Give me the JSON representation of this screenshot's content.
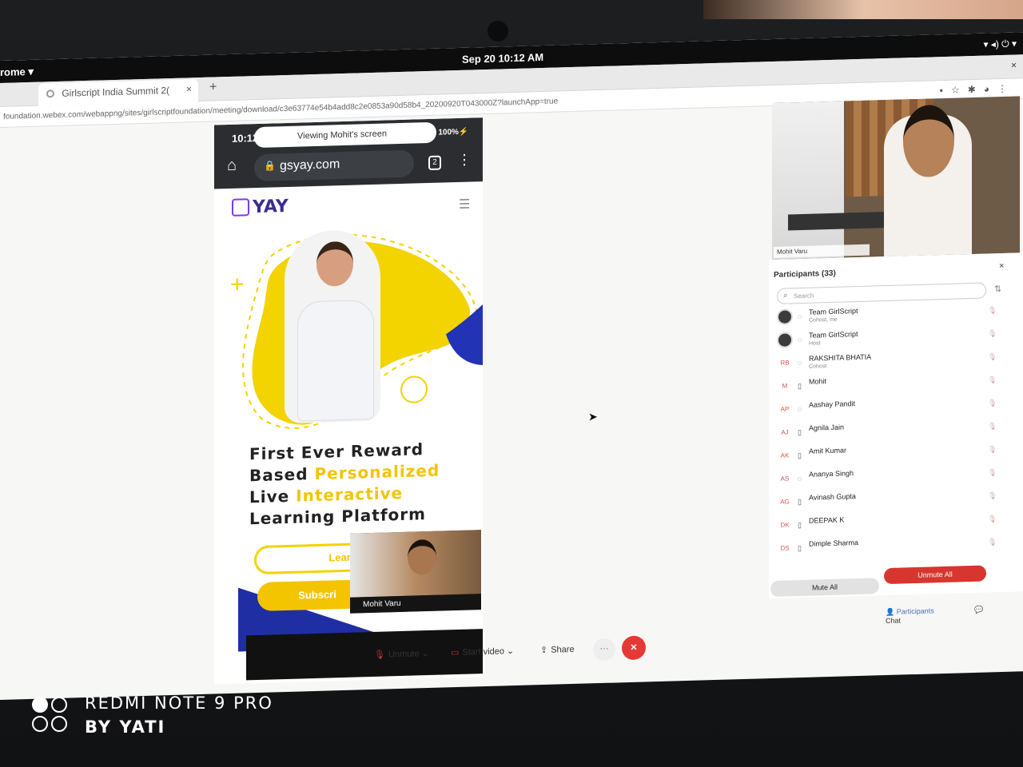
{
  "system": {
    "activities": "rome ▾",
    "clock": "Sep 20  10:12 AM",
    "tray": "▾ ◂) ⏻ ▾"
  },
  "browser": {
    "tab_title": "Girlscript India Summit 2(",
    "tab_close": "×",
    "new_tab": "+",
    "window_close": "×",
    "url": "foundation.webex.com/webappng/sites/girlscriptfoundation/meeting/download/c3e63774e54b4add8c2e0853a90d58b4_20200920T043000Z?launchApp=true",
    "icons": [
      "▪",
      "☆",
      "✱",
      "◕",
      "⋮"
    ]
  },
  "shared_screen": {
    "phone_time": "10:12",
    "viewing_banner": "Viewing Mohit's screen",
    "battery": "ıl 100%⚡",
    "address": "gsyay.com",
    "tab_count": "2",
    "logo_text": "YAY",
    "headline": {
      "line1": "First Ever Reward",
      "line2_a": "Based ",
      "line2_b": "Personalized",
      "line3_a": "Live ",
      "line3_b": "Interactive",
      "line4": "Learning Platform"
    },
    "learn_button": "Learn",
    "subscribe_button": "Subscri"
  },
  "self_view": {
    "name": "Mohit Varu"
  },
  "meeting_controls": {
    "unmute": "Unmute",
    "start_video": "Start video",
    "share": "Share",
    "more": "···",
    "end": "✕"
  },
  "active_speaker": {
    "name": "Mohit Varu"
  },
  "participants_panel": {
    "title": "Participants (33)",
    "search_placeholder": "Search",
    "close": "×",
    "participants": [
      {
        "initials": "",
        "name": "Team GirlScript",
        "role": "Cohost, me",
        "device": "◌"
      },
      {
        "initials": "",
        "name": "Team GirlScript",
        "role": "Host",
        "device": "◌"
      },
      {
        "initials": "RB",
        "name": "RAKSHITA BHATIA",
        "role": "Cohost",
        "device": "◌"
      },
      {
        "initials": "M",
        "name": "Mohit",
        "role": "",
        "device": "▯"
      },
      {
        "initials": "AP",
        "name": "Aashay Pandit",
        "role": "",
        "device": "◌"
      },
      {
        "initials": "AJ",
        "name": "Agnila Jain",
        "role": "",
        "device": "▯"
      },
      {
        "initials": "AK",
        "name": "Amit Kumar",
        "role": "",
        "device": "▯"
      },
      {
        "initials": "AS",
        "name": "Ananya Singh",
        "role": "",
        "device": "◌"
      },
      {
        "initials": "AG",
        "name": "Avinash Gupta",
        "role": "",
        "device": "▯"
      },
      {
        "initials": "DK",
        "name": "DEEPAK K",
        "role": "",
        "device": "▯"
      },
      {
        "initials": "DS",
        "name": "Dimple Sharma",
        "role": "",
        "device": "▯"
      }
    ],
    "mute_all": "Mute All",
    "unmute_all": "Unmute All",
    "tab_participants": "Participants",
    "tab_chat": "Chat"
  },
  "watermark": {
    "line1": "REDMI NOTE 9 PRO",
    "line2": "BY YATI"
  },
  "colors": {
    "accent_yellow": "#f3c400",
    "end_red": "#e53935",
    "brand_blue": "#1f2fa3"
  }
}
